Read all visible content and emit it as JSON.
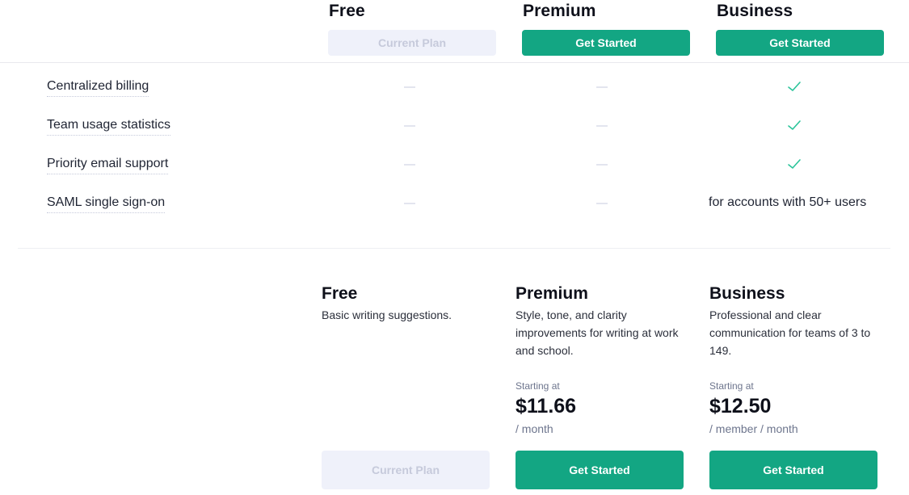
{
  "header": {
    "plans": [
      {
        "name": "Free",
        "button_label": "Current Plan",
        "button_state": "current"
      },
      {
        "name": "Premium",
        "button_label": "Get Started",
        "button_state": "action"
      },
      {
        "name": "Business",
        "button_label": "Get Started",
        "button_state": "action"
      }
    ]
  },
  "features": [
    {
      "label": "Centralized billing",
      "free": "dash-icon",
      "premium": "dash-icon",
      "business": "check-icon"
    },
    {
      "label": "Team usage statistics",
      "free": "dash-icon",
      "premium": "dash-icon",
      "business": "check-icon"
    },
    {
      "label": "Priority email support",
      "free": "dash-icon",
      "premium": "dash-icon",
      "business": "check-icon"
    },
    {
      "label": "SAML single sign-on",
      "free": "dash-icon",
      "premium": "dash-icon",
      "business_text": "for accounts with 50+ users"
    }
  ],
  "plan_cards": [
    {
      "name": "Free",
      "description": "Basic writing suggestions.",
      "button_label": "Current Plan"
    },
    {
      "name": "Premium",
      "description": "Style, tone, and clarity improvements for writing at work and school.",
      "starting_label": "Starting at",
      "price": "$11.66",
      "period": "/ month",
      "button_label": "Get Started"
    },
    {
      "name": "Business",
      "description": "Professional and clear communication for teams of 3 to 149.",
      "starting_label": "Starting at",
      "price": "$12.50",
      "period": "/ member / month",
      "button_label": "Get Started"
    }
  ],
  "colors": {
    "accent": "#13a683",
    "check": "#2ac49a",
    "current_plan_bg": "#eff1fa",
    "current_plan_text": "#c6cadb"
  }
}
